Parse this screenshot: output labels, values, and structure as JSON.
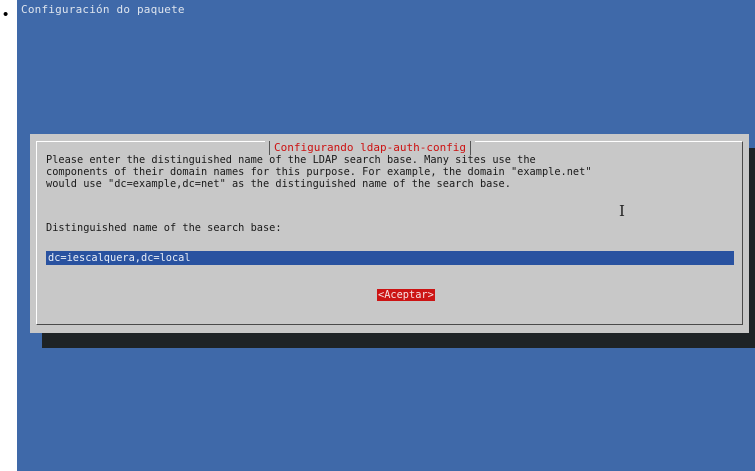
{
  "bullet": "•",
  "screen": {
    "backtitle": "Configuración do paquete"
  },
  "dialog": {
    "title": "Configurando ldap-auth-config",
    "description_lines": [
      "Please enter the distinguished name of the LDAP search base. Many sites use the",
      "components of their domain names for this purpose. For example, the domain \"example.net\"",
      "would use \"dc=example,dc=net\" as the distinguished name of the search base."
    ],
    "field_label": "Distinguished name of the search base:",
    "field_value": "dc=iescalquera,dc=local",
    "ok_button": "<Aceptar>"
  },
  "cursor_glyph": "I",
  "colors": {
    "background": "#3f69a9",
    "dialog": "#c8c8c8",
    "title": "#cc1212",
    "input": "#2952a0",
    "button": "#cc1414",
    "shadow": "#1e2326"
  }
}
